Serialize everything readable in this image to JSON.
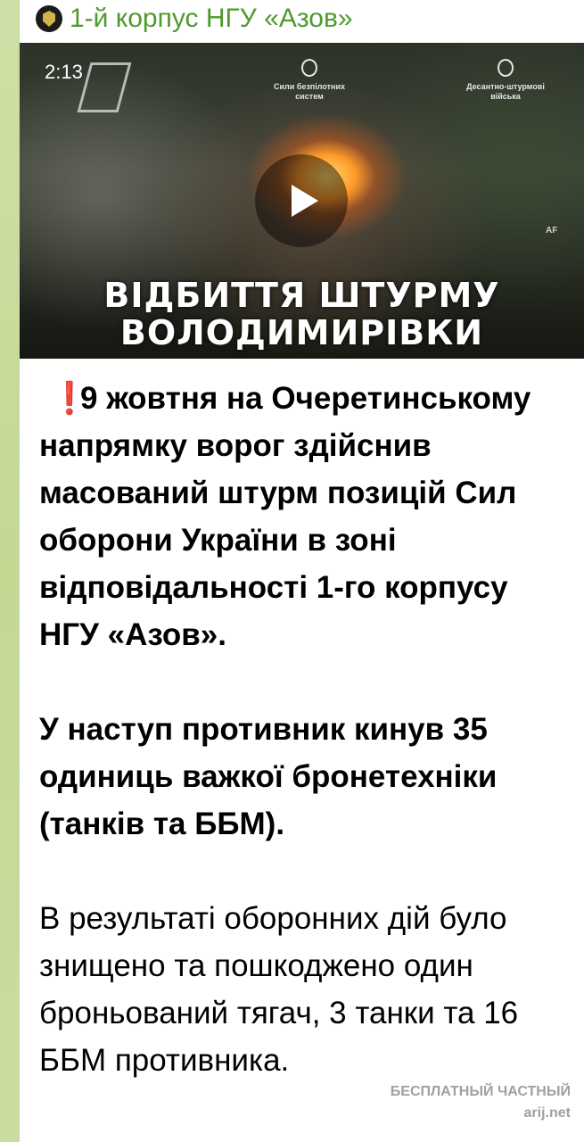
{
  "channel": {
    "name": "1-й корпус НГУ «Азов»",
    "avatar_icon": "azov-emblem-icon",
    "name_color": "#4f9a2d"
  },
  "video": {
    "duration": "2:13",
    "overlay_title_line1": "ВІДБИТТЯ ШТУРМУ",
    "overlay_title_line2": "ВОЛОДИМИРІВКИ",
    "badge_1": "Сили безпілотних систем",
    "badge_2": "Десантно-штурмові війська",
    "corner_mark": "AF",
    "play_icon": "play-icon"
  },
  "message": {
    "alert_icon": "❗",
    "paragraph_1": "9 жовтня на Очеретинському напрямку ворог здійснив масований штурм позицій Сил оборони України в зоні відповідальності 1-го корпусу НГУ «Азов».",
    "paragraph_2": "У наступ противник кинув 35 одиниць важкої бронетехніки (танків та ББМ).",
    "paragraph_3": "В результаті оборонних дій було знищено та пошкоджено один броньований тягач, 3 танки та 16 ББМ противника."
  },
  "watermark": {
    "line1": "БЕСПЛАТНЫЙ ЧАСТНЫЙ",
    "line2": "arij.net"
  }
}
